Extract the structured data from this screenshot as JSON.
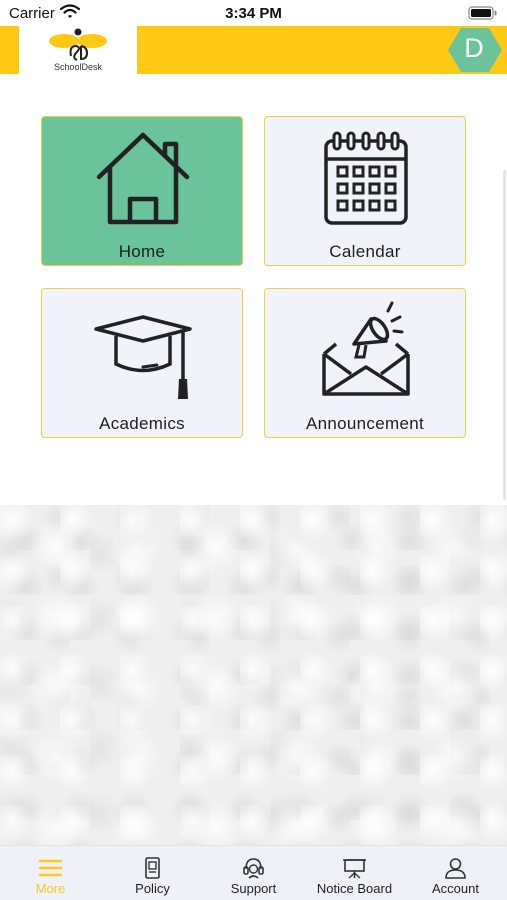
{
  "status_bar": {
    "carrier": "Carrier",
    "time": "3:34 PM"
  },
  "header": {
    "logo_text": "SchoolDesk",
    "avatar_letter": "D",
    "accent_color": "#fdc912",
    "avatar_color": "#6bc39b"
  },
  "tiles": [
    {
      "label": "Home",
      "icon": "house-icon",
      "selected": true
    },
    {
      "label": "Calendar",
      "icon": "calendar-icon",
      "selected": false
    },
    {
      "label": "Academics",
      "icon": "graduation-cap-icon",
      "selected": false
    },
    {
      "label": "Announcement",
      "icon": "megaphone-envelope-icon",
      "selected": false
    }
  ],
  "tab_bar": {
    "tabs": [
      {
        "label": "More",
        "icon": "menu-icon",
        "active": true
      },
      {
        "label": "Policy",
        "icon": "document-icon",
        "active": false
      },
      {
        "label": "Support",
        "icon": "headset-icon",
        "active": false
      },
      {
        "label": "Notice Board",
        "icon": "notice-board-icon",
        "active": false
      },
      {
        "label": "Account",
        "icon": "user-icon",
        "active": false
      }
    ]
  }
}
